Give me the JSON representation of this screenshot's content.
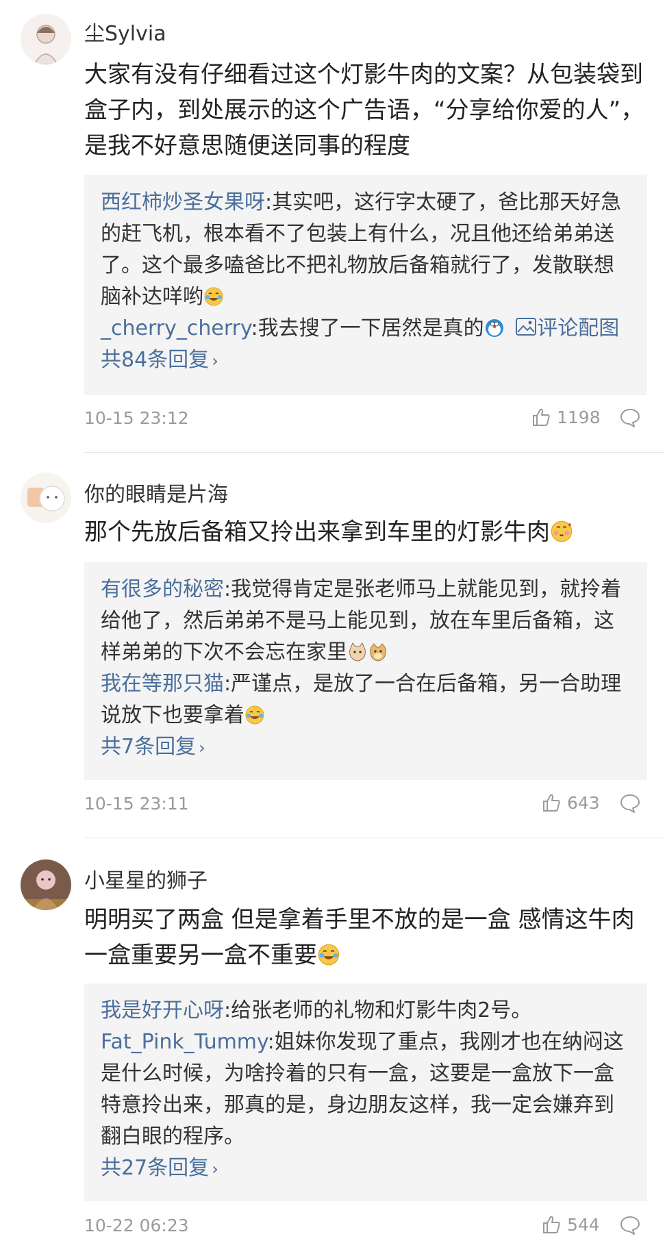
{
  "comments": [
    {
      "username": "尘Sylvia",
      "body": "大家有没有仔细看过这个灯影牛肉的文案？从包装袋到盒子内，到处展示的这个广告语，“分享给你爱的人”，是我不好意思随便送同事的程度",
      "replies": [
        {
          "user": "西红柿炒圣女果呀",
          "text": ":其实吧，这行字太硬了，爸比那天好急的赶飞机，根本看不了包装上有什么，况且他还给弟弟送了。这个最多嗑爸比不把礼物放后备箱就行了，发散联想脑补达咩哟"
        },
        {
          "user": "_cherry_cherry",
          "text": ":我去搜了一下居然是真的",
          "pic_label": "评论配图"
        }
      ],
      "more": "共84条回复",
      "time": "10-15 23:12",
      "likes": "1198"
    },
    {
      "username": "你的眼睛是片海",
      "body": "那个先放后备箱又拎出来拿到车里的灯影牛肉",
      "replies": [
        {
          "user": "有很多的秘密",
          "text": ":我觉得肯定是张老师马上就能见到，就拎着给他了，然后弟弟不是马上能见到，放在车里后备箱，这样弟弟的下次不会忘在家里"
        },
        {
          "user": "我在等那只猫",
          "text": ":严谨点，是放了一合在后备箱，另一合助理说放下也要拿着"
        }
      ],
      "more": "共7条回复",
      "time": "10-15 23:11",
      "likes": "643"
    },
    {
      "username": "小星星的狮子",
      "body": "明明买了两盒 但是拿着手里不放的是一盒 感情这牛肉一盒重要另一盒不重要",
      "replies": [
        {
          "user": "我是好开心呀",
          "text": ":给张老师的礼物和灯影牛肉2号。"
        },
        {
          "user": "Fat_Pink_Tummy",
          "text": ":姐妹你发现了重点，我刚才也在纳闷这是什么时候，为啥拎着的只有一盒，这要是一盒放下一盒特意拎出来，那真的是，身边朋友这样，我一定会嫌弃到翻白眼的程序。"
        }
      ],
      "more": "共27条回复",
      "time": "10-22 06:23",
      "likes": "544"
    }
  ],
  "colors": {
    "link": "#4b6f9c",
    "muted": "#9a9a9a",
    "reply_bg": "#f4f4f4"
  }
}
